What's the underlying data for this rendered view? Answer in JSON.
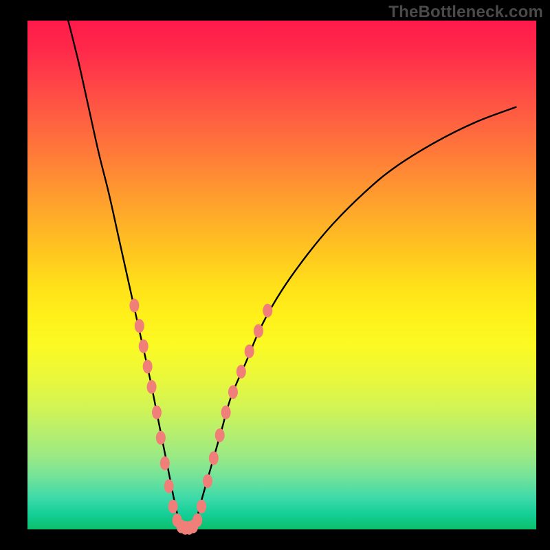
{
  "watermark": "TheBottleneck.com",
  "chart_data": {
    "type": "line",
    "title": "",
    "xlabel": "",
    "ylabel": "",
    "xlim": [
      0,
      100
    ],
    "ylim": [
      0,
      100
    ],
    "series": [
      {
        "name": "curve",
        "x": [
          8,
          10,
          12,
          14,
          16,
          18,
          20,
          22,
          24,
          26,
          27,
          28,
          29,
          30,
          31,
          32,
          33,
          34,
          36,
          38,
          40,
          43,
          46,
          50,
          55,
          60,
          66,
          72,
          80,
          88,
          96
        ],
        "y": [
          100,
          92,
          83,
          74,
          66,
          57,
          48,
          39,
          30,
          20,
          15,
          10,
          5,
          1,
          0,
          0,
          1,
          5,
          12,
          19,
          26,
          33,
          40,
          47,
          54,
          60,
          66,
          71,
          76,
          80,
          83
        ]
      }
    ],
    "bead_clusters": [
      {
        "name": "left-arm-beads",
        "points": [
          [
            21.0,
            44.0
          ],
          [
            22.0,
            40.0
          ],
          [
            22.8,
            36.0
          ],
          [
            23.6,
            32.0
          ],
          [
            24.4,
            28.0
          ],
          [
            25.4,
            23.0
          ],
          [
            26.2,
            18.0
          ],
          [
            27.0,
            13.0
          ],
          [
            27.8,
            8.5
          ],
          [
            28.6,
            4.5
          ],
          [
            29.4,
            1.8
          ]
        ]
      },
      {
        "name": "trough-beads",
        "points": [
          [
            30.2,
            0.6
          ],
          [
            31.0,
            0.3
          ],
          [
            31.8,
            0.3
          ],
          [
            32.6,
            0.6
          ],
          [
            33.4,
            1.8
          ]
        ]
      },
      {
        "name": "right-arm-beads",
        "points": [
          [
            34.2,
            4.5
          ],
          [
            35.4,
            9.5
          ],
          [
            36.6,
            14.0
          ],
          [
            37.8,
            18.5
          ],
          [
            39.0,
            23.0
          ],
          [
            40.4,
            27.0
          ],
          [
            42.0,
            31.0
          ],
          [
            43.6,
            35.0
          ],
          [
            45.4,
            39.0
          ],
          [
            47.2,
            43.0
          ]
        ]
      }
    ],
    "bead_style": {
      "fill": "#f07f7a",
      "rx": 7,
      "ry": 10
    }
  }
}
